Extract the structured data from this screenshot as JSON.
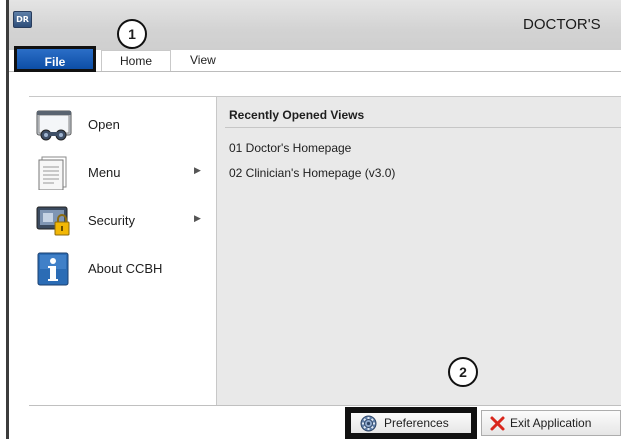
{
  "window": {
    "title": "DOCTOR'S",
    "app_icon_text": "DR"
  },
  "ribbon": {
    "tabs": [
      {
        "label": "File",
        "active": true
      },
      {
        "label": "Home",
        "active": false
      },
      {
        "label": "View",
        "active": false
      }
    ]
  },
  "callouts": {
    "one": "1",
    "two": "2"
  },
  "backstage": {
    "menu": [
      {
        "label": "Open",
        "icon": "open-folder-icon",
        "has_submenu": false
      },
      {
        "label": "Menu",
        "icon": "document-menu-icon",
        "has_submenu": true
      },
      {
        "label": "Security",
        "icon": "security-lock-icon",
        "has_submenu": true
      },
      {
        "label": "About CCBH",
        "icon": "info-icon",
        "has_submenu": false
      }
    ],
    "submenu_arrow": "▶",
    "recent": {
      "heading": "Recently Opened Views",
      "items": [
        "01 Doctor's Homepage",
        "02 Clinician's Homepage (v3.0)"
      ]
    }
  },
  "footer": {
    "preferences_label": "Preferences",
    "exit_label": "Exit Application"
  },
  "colors": {
    "file_tab": "#0d4ea6",
    "pane_background": "#e9e9e9",
    "exit_icon": "#d9261c"
  }
}
